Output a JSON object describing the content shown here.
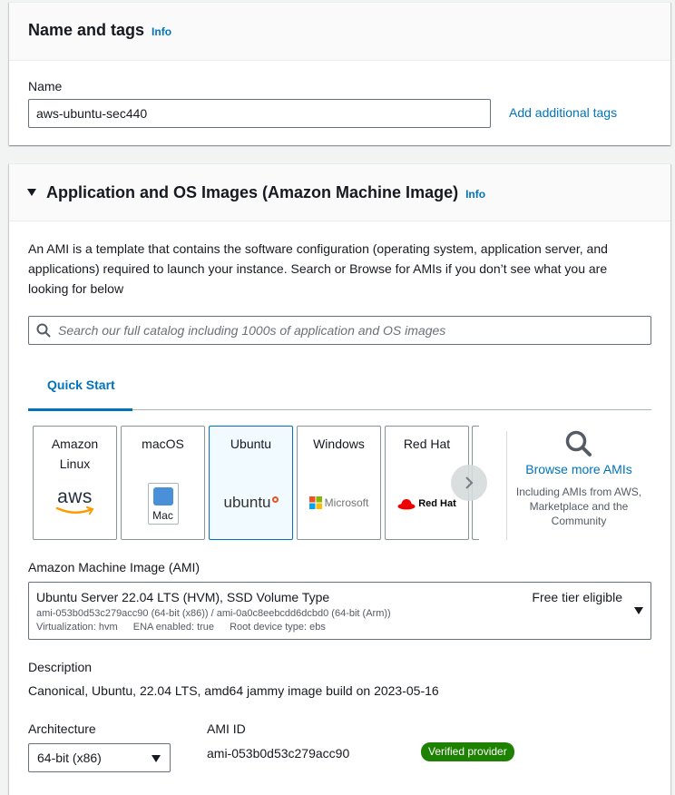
{
  "name_tags": {
    "title": "Name and tags",
    "info": "Info",
    "name_label": "Name",
    "name_value": "aws-ubuntu-sec440",
    "add_tags": "Add additional tags"
  },
  "ami_section": {
    "title": "Application and OS Images (Amazon Machine Image)",
    "info": "Info",
    "description": "An AMI is a template that contains the software configuration (operating system, application server, and applications) required to launch your instance. Search or Browse for AMIs if you don’t see what you are looking for below",
    "search_placeholder": "Search our full catalog including 1000s of application and OS images",
    "tabs": [
      {
        "label": "Quick Start"
      }
    ],
    "os_cards": [
      {
        "name": "Amazon Linux",
        "logo_text": "aws"
      },
      {
        "name": "macOS",
        "logo_text": "Mac"
      },
      {
        "name": "Ubuntu",
        "logo_text": "ubuntu"
      },
      {
        "name": "Windows",
        "logo_text": "Microsoft"
      },
      {
        "name": "Red Hat",
        "logo_text": "Red Hat"
      }
    ],
    "selected_os": "Ubuntu",
    "browse_more": {
      "label": "Browse more AMIs",
      "sub": "Including AMIs from AWS, Marketplace and the Community"
    },
    "ami_label": "Amazon Machine Image (AMI)",
    "ami": {
      "name": "Ubuntu Server 22.04 LTS (HVM), SSD Volume Type",
      "tier": "Free tier eligible",
      "ids": "ami-053b0d53c279acc90 (64-bit (x86)) / ami-0a0c8eebcdd6dcbd0 (64-bit (Arm))",
      "virtualization": "Virtualization: hvm",
      "ena": "ENA enabled: true",
      "root_device": "Root device type: ebs"
    },
    "description_label": "Description",
    "description_value": "Canonical, Ubuntu, 22.04 LTS, amd64 jammy image build on 2023-05-16",
    "architecture_label": "Architecture",
    "architecture_value": "64-bit (x86)",
    "ami_id_label": "AMI ID",
    "ami_id_value": "ami-053b0d53c279acc90",
    "verified_badge": "Verified provider"
  },
  "colors": {
    "link": "#0073bb",
    "badge_green": "#1d8102",
    "selected_card_bg": "#f1faff",
    "ubuntu_orange": "#e95420",
    "redhat_red": "#ee0000"
  }
}
